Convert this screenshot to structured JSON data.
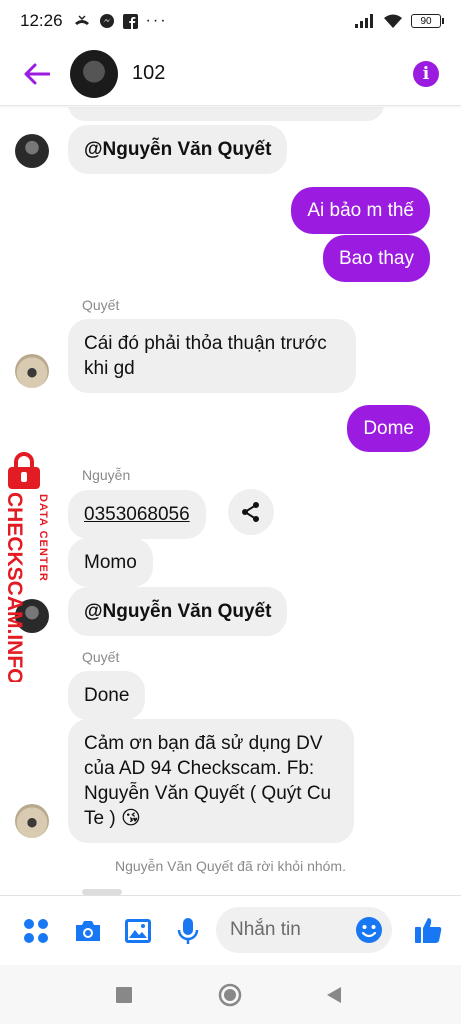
{
  "status": {
    "time": "12:26",
    "battery": "90"
  },
  "header": {
    "title": "102"
  },
  "messages": {
    "top_mention": "@Nguyễn Văn Quyết",
    "out1": "Ai bảo m thế",
    "out2": "Bao thay",
    "sender_quyet_1": "Quyết",
    "in_agreement_line1": "Cái đó phải thỏa thuận trước",
    "in_agreement_line2": "khi gd",
    "out3": "Dome",
    "sender_nguyen": "Nguyễn",
    "phone": "0353068056",
    "momo": "Momo",
    "mention2": "@Nguyễn Văn Quyết",
    "sender_quyet_2": "Quyết",
    "done": "Done",
    "thanks_line1": "Cảm ơn bạn đã sử dụng DV",
    "thanks_line2": "của AD 94 Checkscam. Fb:",
    "thanks_line3": "Nguyễn Văn Quyết ( Quýt Cu",
    "thanks_line4": "Te ) 😘",
    "system_left": "Nguyễn Văn Quyết đã rời khỏi nhóm."
  },
  "watermark": {
    "line1": "DATA CENTER",
    "line2": "CHECKSCAM.INFO"
  },
  "composer": {
    "placeholder": "Nhắn tin"
  },
  "colors": {
    "accent": "#9b1be0",
    "blue": "#1877f2",
    "watermark": "#e31b23"
  }
}
